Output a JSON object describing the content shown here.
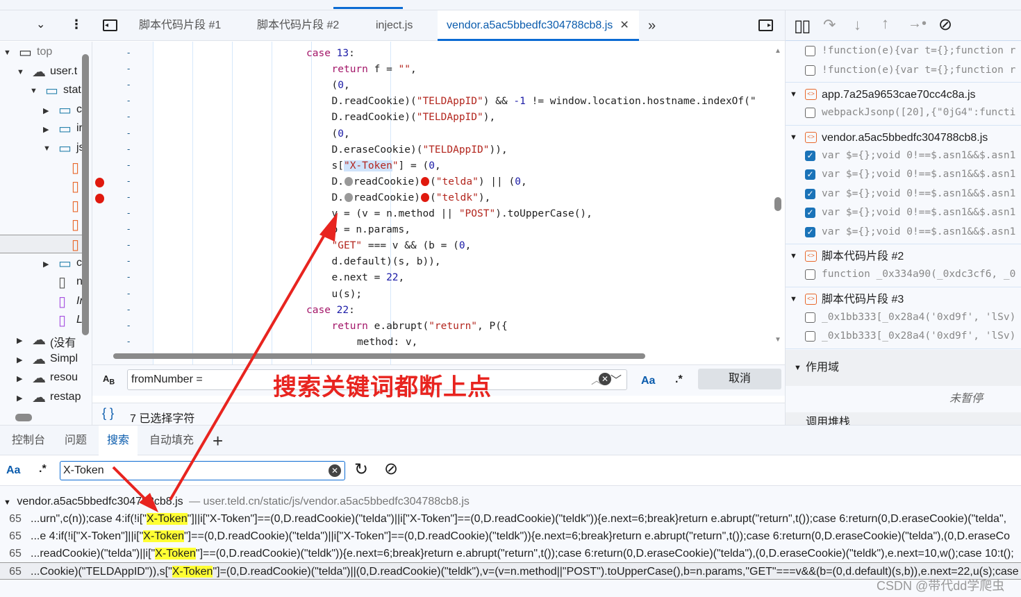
{
  "top_tabs": {
    "active_underline": true
  },
  "tab_bar": {
    "tabs": [
      {
        "label": "脚本代码片段 #1"
      },
      {
        "label": "脚本代码片段 #2"
      },
      {
        "label": "inject.js"
      },
      {
        "label": "vendor.a5ac5bbedfc304788cb8.js",
        "active": true
      }
    ],
    "more": "»"
  },
  "navigator": {
    "items": [
      {
        "label": "top",
        "icon": "frame-icon",
        "arrow": "▼",
        "indent": 0
      },
      {
        "label": "user.t",
        "icon": "cloud-icon",
        "arrow": "▼",
        "indent": 1
      },
      {
        "label": "stat",
        "icon": "folder-icon",
        "arrow": "▼",
        "indent": 2
      },
      {
        "label": "c",
        "icon": "folder-icon",
        "arrow": "▶",
        "indent": 3
      },
      {
        "label": "ir",
        "icon": "folder-icon",
        "arrow": "▶",
        "indent": 3
      },
      {
        "label": "js",
        "icon": "folder-icon",
        "arrow": "▼",
        "indent": 3
      },
      {
        "label": "",
        "icon": "file-js-icon",
        "indent": 4
      },
      {
        "label": "",
        "icon": "file-js-icon",
        "indent": 4
      },
      {
        "label": "",
        "icon": "file-js-icon",
        "indent": 4
      },
      {
        "label": "",
        "icon": "file-js-icon",
        "indent": 4
      },
      {
        "label": "",
        "icon": "file-js-icon",
        "indent": 4,
        "selected": true
      },
      {
        "label": "c",
        "icon": "folder-icon",
        "arrow": "▶",
        "indent": 3
      },
      {
        "label": "nev",
        "icon": "file-icon",
        "indent": 3
      },
      {
        "label": "Inte",
        "icon": "file-purple-icon",
        "indent": 3,
        "italic": true
      },
      {
        "label": "Log",
        "icon": "file-purple-icon",
        "indent": 3,
        "italic": true
      },
      {
        "label": "(没有",
        "icon": "cloud-icon",
        "arrow": "▶",
        "indent": 1
      },
      {
        "label": "Simpl",
        "icon": "cloud-icon",
        "arrow": "▶",
        "indent": 1
      },
      {
        "label": "resou",
        "icon": "cloud-icon",
        "arrow": "▶",
        "indent": 1
      },
      {
        "label": "restap",
        "icon": "cloud-icon",
        "arrow": "▶",
        "indent": 1
      }
    ]
  },
  "editor": {
    "breakpoint_lines": [
      8,
      9
    ],
    "lines": [
      {
        "indent": 0,
        "tokens": [
          [
            "case",
            "kw"
          ],
          [
            " "
          ],
          [
            "13",
            "num"
          ],
          [
            ":"
          ]
        ]
      },
      {
        "indent": 1,
        "tokens": [
          [
            "return",
            "kw"
          ],
          [
            " f = "
          ],
          [
            "\"\"",
            "str"
          ],
          [
            ","
          ]
        ]
      },
      {
        "indent": 1,
        "tokens": [
          [
            "("
          ],
          [
            "0",
            "num"
          ],
          [
            ","
          ]
        ]
      },
      {
        "indent": 1,
        "tokens": [
          [
            "D.readCookie)("
          ],
          [
            "\"TELDAppID\"",
            "str"
          ],
          [
            ") && "
          ],
          [
            "-1",
            "num"
          ],
          [
            " != window.location.hostname.indexOf(\""
          ]
        ]
      },
      {
        "indent": 1,
        "tokens": [
          [
            "D.readCookie)("
          ],
          [
            "\"TELDAppID\"",
            "str"
          ],
          [
            "),"
          ]
        ]
      },
      {
        "indent": 1,
        "tokens": [
          [
            "("
          ],
          [
            "0",
            "num"
          ],
          [
            ","
          ]
        ]
      },
      {
        "indent": 1,
        "tokens": [
          [
            "D.eraseCookie)("
          ],
          [
            "\"TELDAppID\"",
            "str"
          ],
          [
            ")),"
          ]
        ]
      },
      {
        "indent": 1,
        "tokens": [
          [
            "s["
          ],
          [
            "\"X-Token",
            "str sel-hl"
          ],
          [
            "\"",
            "str"
          ],
          [
            "] = ("
          ],
          [
            "0",
            "num"
          ],
          [
            ","
          ]
        ]
      },
      {
        "indent": 1,
        "tokens": [
          [
            "D."
          ],
          [
            "",
            "ibp gray"
          ],
          [
            "readCookie)"
          ],
          [
            "",
            "ibp red"
          ],
          [
            "("
          ],
          [
            "\"telda\"",
            "str"
          ],
          [
            ") || ("
          ],
          [
            "0",
            "num"
          ],
          [
            ","
          ]
        ]
      },
      {
        "indent": 1,
        "tokens": [
          [
            "D."
          ],
          [
            "",
            "ibp gray"
          ],
          [
            "readCookie)"
          ],
          [
            "",
            "ibp red"
          ],
          [
            "("
          ],
          [
            "\"teldk\"",
            "str"
          ],
          [
            "),"
          ]
        ]
      },
      {
        "indent": 1,
        "tokens": [
          [
            "v = (v = n.method || "
          ],
          [
            "\"POST\"",
            "str"
          ],
          [
            ").toUpperCase(),"
          ]
        ]
      },
      {
        "indent": 1,
        "tokens": [
          [
            "b = n.params,"
          ]
        ]
      },
      {
        "indent": 1,
        "tokens": [
          [
            "\"GET\"",
            "str"
          ],
          [
            " === v && (b = ("
          ],
          [
            "0",
            "num"
          ],
          [
            ","
          ]
        ]
      },
      {
        "indent": 1,
        "tokens": [
          [
            "d.default)(s, b)),"
          ]
        ]
      },
      {
        "indent": 1,
        "tokens": [
          [
            "e.next = "
          ],
          [
            "22",
            "num"
          ],
          [
            ","
          ]
        ]
      },
      {
        "indent": 1,
        "tokens": [
          [
            "u(s);"
          ]
        ]
      },
      {
        "indent": 0,
        "tokens": [
          [
            "case",
            "kw"
          ],
          [
            " "
          ],
          [
            "22",
            "num"
          ],
          [
            ":"
          ]
        ]
      },
      {
        "indent": 1,
        "tokens": [
          [
            "return",
            "kw"
          ],
          [
            " e.abrupt("
          ],
          [
            "\"return\"",
            "str"
          ],
          [
            ", P({"
          ]
        ]
      },
      {
        "indent": 2,
        "tokens": [
          [
            "method: v,"
          ]
        ]
      }
    ]
  },
  "find_bar": {
    "value": "fromNumber =",
    "case_label": "Aa",
    "regex_label": ".*",
    "cancel": "取消"
  },
  "status": {
    "braces": "{ }",
    "selection": "7 已选择字符"
  },
  "debugger": {
    "groups": [
      {
        "rows": [
          {
            "text": "!function(e){var t={};function r",
            "checked": false
          },
          {
            "text": "!function(e){var t={};function r",
            "checked": false
          }
        ]
      },
      {
        "file": "app.7a25a9653cae70cc4c8a.js",
        "rows": [
          {
            "text": "webpackJsonp([20],{\"0jG4\":functi",
            "checked": false
          }
        ]
      },
      {
        "file": "vendor.a5ac5bbedfc304788cb8.js",
        "rows": [
          {
            "text": "var $={};void 0!==$.asn1&&$.asn1",
            "checked": true
          },
          {
            "text": "var $={};void 0!==$.asn1&&$.asn1",
            "checked": true
          },
          {
            "text": "var $={};void 0!==$.asn1&&$.asn1",
            "checked": true
          },
          {
            "text": "var $={};void 0!==$.asn1&&$.asn1",
            "checked": true
          },
          {
            "text": "var $={};void 0!==$.asn1&&$.asn1",
            "checked": true
          }
        ]
      },
      {
        "file": "脚本代码片段 #2",
        "rows": [
          {
            "text": "function _0x334a90(_0xdc3cf6, _0",
            "checked": false
          }
        ]
      },
      {
        "file": "脚本代码片段 #3",
        "rows": [
          {
            "text": "_0x1bb333[_0x28a4('0xd9f', 'lSv)",
            "checked": false
          },
          {
            "text": "_0x1bb333[_0x28a4('0xd9f', 'lSv)",
            "checked": false
          }
        ]
      }
    ],
    "scope": "作用域",
    "not_paused": "未暂停",
    "call_stack": "调用堆栈"
  },
  "drawer": {
    "tabs": [
      {
        "label": "控制台"
      },
      {
        "label": "问题"
      },
      {
        "label": "搜索",
        "active": true
      },
      {
        "label": "自动填充"
      }
    ],
    "add": "+"
  },
  "search": {
    "case_label": "Aa",
    "regex_label": ".*",
    "value": "X-Token",
    "file": "vendor.a5ac5bbedfc304788cb8.js",
    "url": "— user.teld.cn/static/js/vendor.a5ac5bbedfc304788cb8.js",
    "results": [
      {
        "line": "65",
        "pre": "...urn\",c(n));case 4:if(!i[\"",
        "match": "X-Token",
        "post": "\"]||i[\"X-Token\"]==(0,D.readCookie)(\"telda\")||i[\"X-Token\"]==(0,D.readCookie)(\"teldk\")){e.next=6;break}return e.abrupt(\"return\",t());case 6:return(0,D.eraseCookie)(\"telda\","
      },
      {
        "line": "65",
        "pre": "...e 4:if(!i[\"X-Token\"]||i[\"",
        "match": "X-Token",
        "post": "\"]==(0,D.readCookie)(\"telda\")||i[\"X-Token\"]==(0,D.readCookie)(\"teldk\")){e.next=6;break}return e.abrupt(\"return\",t());case 6:return(0,D.eraseCookie)(\"telda\"),(0,D.eraseCo"
      },
      {
        "line": "65",
        "pre": "...readCookie)(\"telda\")||i[\"",
        "match": "X-Token",
        "post": "\"]==(0,D.readCookie)(\"teldk\")){e.next=6;break}return e.abrupt(\"return\",t());case 6:return(0,D.eraseCookie)(\"telda\"),(0,D.eraseCookie)(\"teldk\"),e.next=10,w();case 10:t();"
      },
      {
        "line": "65",
        "pre": "...Cookie)(\"TELDAppID\")),s[\"",
        "match": "X-Token",
        "post": "\"]=(0,D.readCookie)(\"telda\")||(0,D.readCookie)(\"teldk\"),v=(v=n.method||\"POST\").toUpperCase(),b=n.params,\"GET\"===v&&(b=(0,d.default)(s,b)),e.next=22,u(s);case",
        "current": true
      }
    ]
  },
  "annotation": {
    "text": "搜索关键词都断上点",
    "color": "#e8241f"
  },
  "watermark": "CSDN @带代dd学爬虫",
  "colors": {
    "accent": "#0b6bd3",
    "breakpoint": "#e0190e",
    "highlight": "#ffff33"
  }
}
